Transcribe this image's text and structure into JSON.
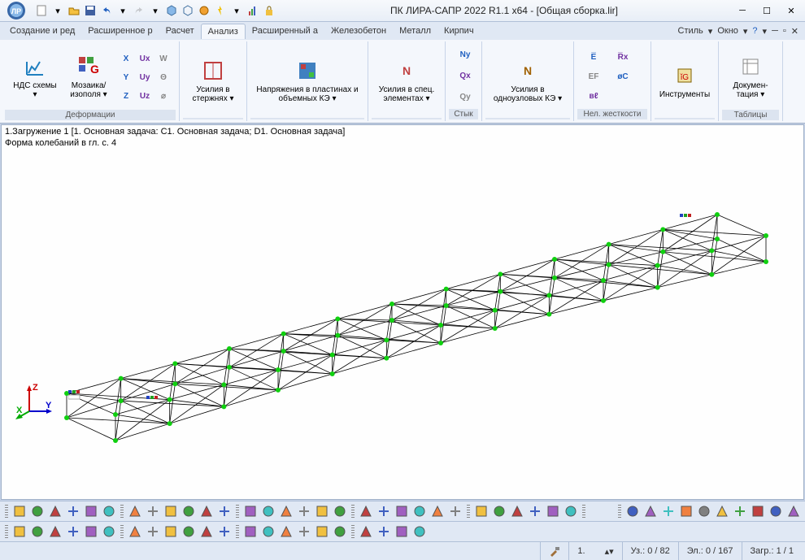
{
  "title": "ПК ЛИРА-САПР  2022 R1.1 x64 - [Общая сборка.lir]",
  "menu": {
    "style": "Стиль",
    "window": "Окно"
  },
  "tabs": [
    "Создание и ред",
    "Расширенное р",
    "Расчет",
    "Анализ",
    "Расширенный а",
    "Железобетон",
    "Металл",
    "Кирпич"
  ],
  "activeTab": 3,
  "ribbon": {
    "g1": {
      "label": "Деформации",
      "btn1": "НДС схемы ▾",
      "btn2": "Мозаика/ изополя ▾",
      "minis": [
        "X",
        "Ux",
        "W",
        "Y",
        "Uy",
        "Θ",
        "Z",
        "Uz",
        "⌀"
      ]
    },
    "g2": {
      "label": "",
      "btn": "Усилия в стержнях ▾"
    },
    "g3": {
      "label": "",
      "btn": "Напряжения в пластинах и объемных КЭ ▾"
    },
    "g4": {
      "label": "",
      "btn": "Усилия в спец. элементах ▾"
    },
    "g5": {
      "label": "Стык",
      "minis": [
        "Ny",
        "Qx",
        "Qy"
      ]
    },
    "g6": {
      "label": "",
      "btn": "Усилия в одноузловых КЭ ▾"
    },
    "g7": {
      "label": "Нел. жесткости",
      "minis": [
        "E̅",
        "R̅x",
        "EF",
        "øC",
        "вℓ"
      ]
    },
    "g8": {
      "label": "",
      "btn": "Инструменты"
    },
    "g9": {
      "label": "Таблицы",
      "btn": "Докумен-тация ▾"
    }
  },
  "vp": {
    "line1": "1.Загружение 1 [1. Основная задача: C1. Основная задача; D1. Основная задача]",
    "line2": "Форма колебаний в гл. с.  4"
  },
  "status": {
    "nodes": "Уз.: 0 / 82",
    "elems": "Эл.: 0 / 167",
    "load": "Загр.: 1 / 1",
    "spin": "1."
  }
}
